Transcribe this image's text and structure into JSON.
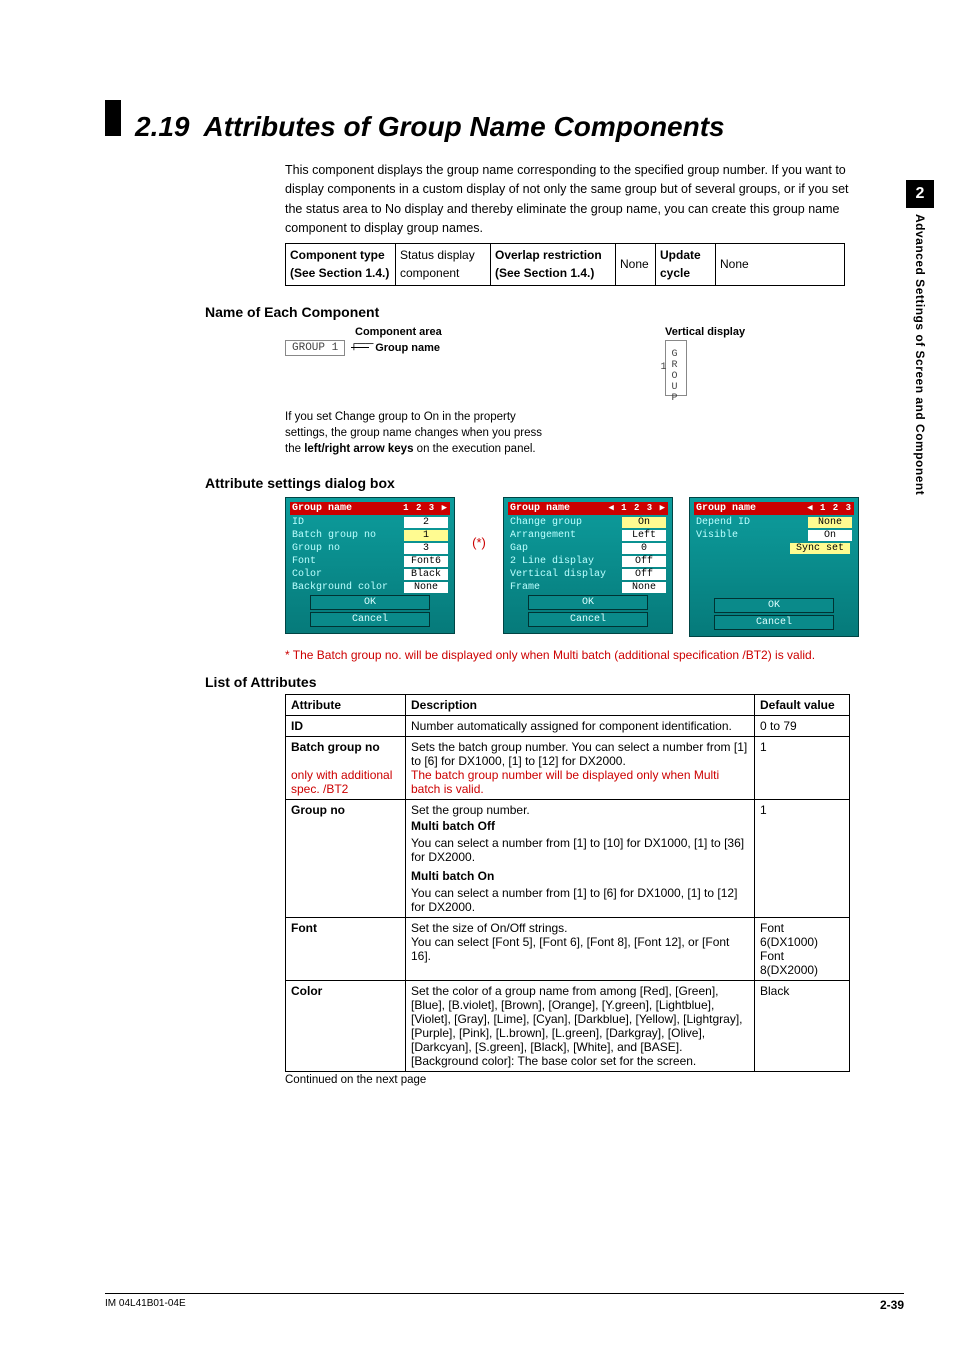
{
  "section": {
    "num": "2.19",
    "title": "Attributes of Group Name Components"
  },
  "intro": "This component displays the group name corresponding to the specified group number. If you want to display components in a custom display of not only the same group but of several groups, or if you set the status area to No display and thereby eliminate the group name, you can create this group name component to display group names.",
  "meta": {
    "c1l": "Component type (See Section 1.4.)",
    "c1v": "Status display component",
    "c2l": "Overlap restriction (See Section 1.4.)",
    "c2v": "None",
    "c3l": "Update cycle",
    "c3v": "None"
  },
  "h_name": "Name of Each Component",
  "comp_area_label": "Component area",
  "group_name_label": "Group name",
  "group_box_text": "GROUP 1",
  "note_text_1": "If you set Change group to On in the property settings, the group name changes when you press the ",
  "note_bold": "left/right arrow keys",
  "note_text_2": " on the execution panel.",
  "vd_label": "Vertical display",
  "vd_box_text": "GROUP 1",
  "h_dlg": "Attribute settings dialog box",
  "star": "(*)",
  "dlg1": {
    "title": "Group name",
    "arrows": "1 2 3 ▶",
    "rows": [
      {
        "k": "ID",
        "v": "2",
        "hl": false
      },
      {
        "k": "Batch group no",
        "v": "1",
        "hl": true
      },
      {
        "k": "Group no",
        "v": "3",
        "hl": false
      },
      {
        "k": "Font",
        "v": "Font6",
        "hl": false
      },
      {
        "k": "Color",
        "v": "Black",
        "hl": false
      },
      {
        "k": "Background color",
        "v": "None",
        "hl": false
      }
    ],
    "ok": "OK",
    "cancel": "Cancel"
  },
  "dlg2": {
    "title": "Group name",
    "arrows": "◀ 1 2 3 ▶",
    "rows": [
      {
        "k": "Change group",
        "v": "On",
        "hl": true
      },
      {
        "k": "Arrangement",
        "v": "Left",
        "hl": false
      },
      {
        "k": "Gap",
        "v": "0",
        "hl": false
      },
      {
        "k": "2 Line display",
        "v": "Off",
        "hl": false
      },
      {
        "k": "Vertical display",
        "v": "Off",
        "hl": false
      },
      {
        "k": "Frame",
        "v": "None",
        "hl": false
      }
    ],
    "ok": "OK",
    "cancel": "Cancel"
  },
  "dlg3": {
    "title": "Group name",
    "arrows": "◀ 1 2 3",
    "rows": [
      {
        "k": "Depend ID",
        "v": "None",
        "hl": true
      },
      {
        "k": "Visible",
        "v": "On",
        "hl": false
      }
    ],
    "sync": "Sync set",
    "ok": "OK",
    "cancel": "Cancel"
  },
  "footnote": "* The Batch group no. will be displayed only when Multi batch (additional specification /BT2) is valid.",
  "h_loa": "List of Attributes",
  "attr_head": {
    "a": "Attribute",
    "d": "Description",
    "v": "Default value"
  },
  "attrs": {
    "id": {
      "l": "ID",
      "d": "Number automatically assigned for component identification.",
      "v": "0 to 79"
    },
    "bg": {
      "l": "Batch group no",
      "l2": "only with additional spec. /BT2",
      "d1": "Sets the batch group number. You can select a number from [1] to [6] for DX1000, [1] to [12] for DX2000.",
      "d2": "The batch group number will be displayed only when Multi batch is valid.",
      "v": "1"
    },
    "gn": {
      "l": "Group no",
      "d0": "Set the group number.",
      "h1": "Multi batch Off",
      "d1": "You can select a number from [1] to [10] for DX1000, [1] to [36] for DX2000.",
      "h2": "Multi batch On",
      "d2": "You can select a number from [1] to [6] for DX1000, [1] to [12] for DX2000.",
      "v": "1"
    },
    "font": {
      "l": "Font",
      "d1": "Set the size of On/Off strings.",
      "d2": "You can select [Font 5], [Font 6], [Font 8], [Font 12], or [Font 16].",
      "v": "Font 6(DX1000) Font 8(DX2000)"
    },
    "color": {
      "l": "Color",
      "d": "Set the color of a group name from among [Red], [Green], [Blue], [B.violet], [Brown], [Orange], [Y.green], [Lightblue], [Violet], [Gray], [Lime], [Cyan], [Darkblue], [Yellow], [Lightgray], [Purple], [Pink], [L.brown], [L.green], [Darkgray], [Olive], [Darkcyan], [S.green], [Black], [White], and [BASE].\n[Background color]: The base color set for the screen.",
      "v": "Black"
    }
  },
  "cont": "Continued on the next page",
  "sidebar": {
    "num": "2",
    "text": "Advanced Settings of Screen and Component"
  },
  "footer": {
    "left": "IM 04L41B01-04E",
    "right": "2-39"
  }
}
